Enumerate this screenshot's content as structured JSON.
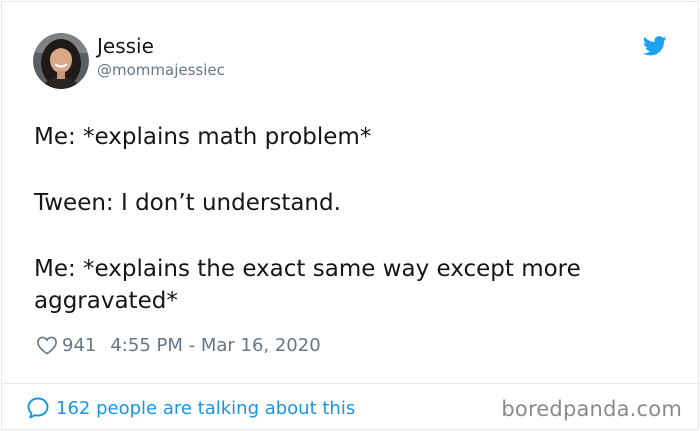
{
  "author": {
    "name": "Jessie",
    "handle": "@mommajessiec",
    "avatar_icon": "profile-photo"
  },
  "tweet": {
    "paragraphs": [
      "Me: *explains math problem*",
      "Tween: I don’t understand.",
      "Me: *explains the exact same way except more aggravated*"
    ],
    "likes": "941",
    "timestamp": "4:55 PM - Mar 16, 2020"
  },
  "footer": {
    "conversation_label": "162 people are talking about this"
  },
  "watermark": "boredpanda.com",
  "colors": {
    "twitter_blue": "#1da1f2",
    "link_blue": "#1b95e0",
    "muted_gray": "#657786",
    "text": "#14171a",
    "border": "#e1e8ed"
  },
  "icons": {
    "bird": "twitter-bird-icon",
    "heart": "heart-icon",
    "reply": "speech-bubble-icon"
  }
}
